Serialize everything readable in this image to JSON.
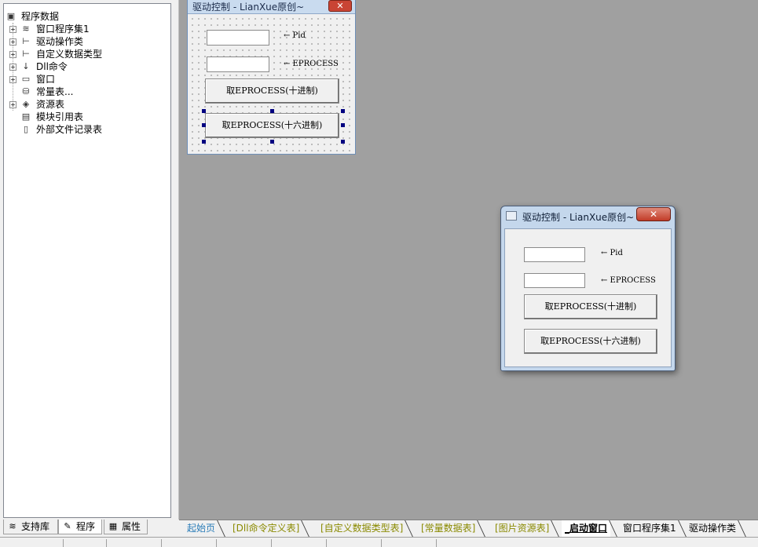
{
  "tree": {
    "root_label": "程序数据",
    "items": [
      {
        "label": "窗口程序集1",
        "icon": "stack-icon",
        "expandable": true
      },
      {
        "label": "驱动操作类",
        "icon": "class-icon",
        "expandable": true
      },
      {
        "label": "自定义数据类型",
        "icon": "struct-icon",
        "expandable": true
      },
      {
        "label": "Dll命令",
        "icon": "dll-icon",
        "expandable": true
      },
      {
        "label": "窗口",
        "icon": "window-icon",
        "expandable": true
      },
      {
        "label": "常量表...",
        "icon": "constants-icon",
        "expandable": false
      },
      {
        "label": "资源表",
        "icon": "resources-icon",
        "expandable": true
      },
      {
        "label": "模块引用表",
        "icon": "module-icon",
        "expandable": false
      },
      {
        "label": "外部文件记录表",
        "icon": "file-icon",
        "expandable": false
      }
    ]
  },
  "left_tabs": [
    {
      "label": "支持库",
      "icon": "library-icon"
    },
    {
      "label": "程序",
      "icon": "program-icon",
      "active": true
    },
    {
      "label": "属性",
      "icon": "properties-icon"
    }
  ],
  "design_form": {
    "title": "驱动控制 - LianXue原创~",
    "close_glyph": "✕",
    "pid_label": "← Pid",
    "eprocess_label": "← EPROCESS",
    "btn_dec": "取EPROCESS(十进制)",
    "btn_hex": "取EPROCESS(十六进制)"
  },
  "preview_window": {
    "title": "驱动控制 - LianXue原创~",
    "close_glyph": "✕",
    "pid_label": "← Pid",
    "eprocess_label": "← EPROCESS",
    "btn_dec": "取EPROCESS(十进制)",
    "btn_hex": "取EPROCESS(十六进制)"
  },
  "doc_tabs": [
    {
      "label": "起始页",
      "color": "#2a7cb8"
    },
    {
      "label": "[Dll命令定义表]",
      "color": "#8a8a00"
    },
    {
      "label": "[自定义数据类型表]",
      "color": "#8a8a00"
    },
    {
      "label": "[常量数据表]",
      "color": "#8a8a00"
    },
    {
      "label": "[图片资源表]",
      "color": "#8a8a00"
    },
    {
      "label": "_启动窗口",
      "color": "#000000",
      "active": true
    },
    {
      "label": "窗口程序集1",
      "color": "#000000"
    },
    {
      "label": "驱动操作类",
      "color": "#000000"
    }
  ],
  "colors": {
    "canvas_bg": "#a0a0a0",
    "form_bg": "#f0f0f0",
    "selection_handle": "#000080",
    "close_button": "#c23c28"
  }
}
